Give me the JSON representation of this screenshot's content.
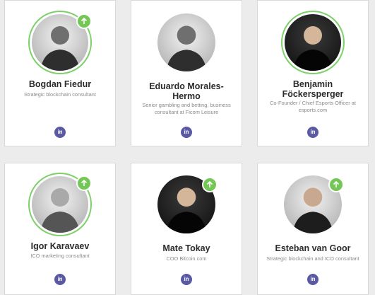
{
  "team": {
    "members": [
      {
        "name": "Bogdan Fiedur",
        "role": "Strategic blockchain consultant",
        "social_icon": "linkedin-icon",
        "badge_icon": "arrow-up-icon"
      },
      {
        "name": "Eduardo Morales-Hermo",
        "role": "Senior gambling and betting, business consultant at Ficom Leisure",
        "social_icon": "linkedin-icon"
      },
      {
        "name": "Benjamin Föckersperger",
        "role": "Co-Founder / Chief Esports Officer at esports.com",
        "social_icon": "linkedin-icon"
      },
      {
        "name": "Igor Karavaev",
        "role": "ICO marketing consultant",
        "social_icon": "linkedin-icon",
        "badge_icon": "arrow-up-icon"
      },
      {
        "name": "Mate Tokay",
        "role": "COO Bitcoin.com",
        "social_icon": "linkedin-icon",
        "badge_icon": "arrow-up-icon"
      },
      {
        "name": "Esteban van Goor",
        "role": "Strategic blockchain and ICO consultant",
        "social_icon": "linkedin-icon",
        "badge_icon": "arrow-up-icon"
      }
    ],
    "linkedin_label": "in",
    "colors": {
      "accent_green": "#74c757",
      "linkedin": "#5a59a6",
      "name": "#2b2b2b",
      "role": "#8a8a8a"
    }
  }
}
